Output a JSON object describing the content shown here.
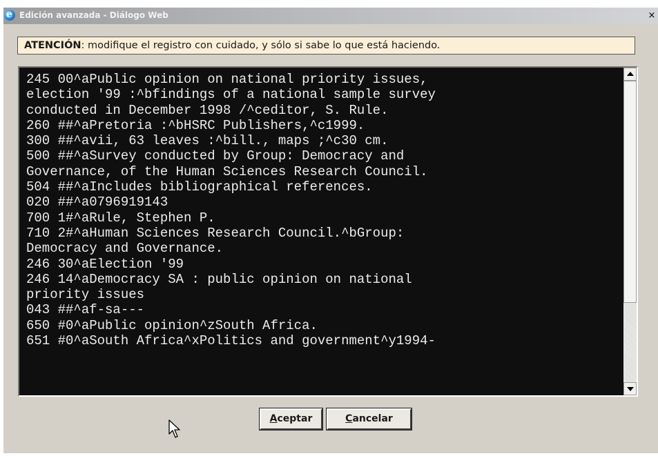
{
  "window": {
    "title": "Edición avanzada - Diálogo Web",
    "close_label": "×"
  },
  "warning": {
    "bold": "ATENCIÓN",
    "text": ": modifique el registro con cuidado, y sólo si sabe lo que está haciendo."
  },
  "editor": {
    "content": "245 00^aPublic opinion on national priority issues,\nelection '99 :^bfindings of a national sample survey\nconducted in December 1998 /^ceditor, S. Rule.\n260 ##^aPretoria :^bHSRC Publishers,^c1999.\n300 ##^avii, 63 leaves :^bill., maps ;^c30 cm.\n500 ##^aSurvey conducted by Group: Democracy and\nGovernance, of the Human Sciences Research Council.\n504 ##^aIncludes bibliographical references.\n020 ##^a0796919143\n700 1#^aRule, Stephen P.\n710 2#^aHuman Sciences Research Council.^bGroup:\nDemocracy and Governance.\n246 30^aElection '99\n246 14^aDemocracy SA : public opinion on national\npriority issues\n043 ##^af-sa---\n650 #0^aPublic opinion^zSouth Africa.\n651 #0^aSouth Africa^xPolitics and government^y1994-"
  },
  "buttons": {
    "accept_prefix": "A",
    "accept_rest": "ceptar",
    "cancel_prefix": "C",
    "cancel_rest": "ancelar"
  },
  "icons": {
    "window_icon": "internet-explorer-icon",
    "pointer": "mouse-pointer-icon"
  }
}
